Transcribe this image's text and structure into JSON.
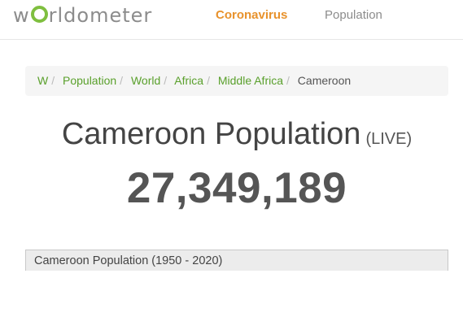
{
  "header": {
    "logo_part1": "w",
    "logo_part2": "rldometer",
    "logo_o_icon": "ring-o",
    "nav": [
      {
        "label": "Coronavirus",
        "color": "#e8922c"
      },
      {
        "label": "Population",
        "color": "#8c8c8c"
      }
    ]
  },
  "breadcrumb": {
    "items": [
      "W",
      "Population",
      "World",
      "Africa",
      "Middle Africa"
    ],
    "separator": "/",
    "current": "Cameroon",
    "link_color": "#5aa02c"
  },
  "main": {
    "title": "Cameroon Population",
    "live_label": "(LIVE)",
    "population_counter": "27,349,189",
    "chart_header": "Cameroon Population (1950 - 2020)"
  }
}
